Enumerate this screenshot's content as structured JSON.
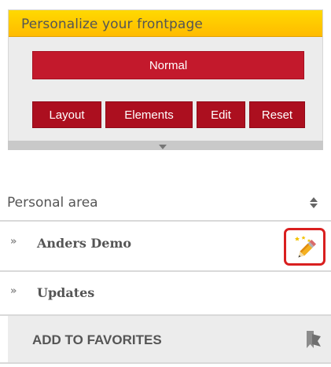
{
  "panel": {
    "title": "Personalize your frontpage",
    "mode_label": "Normal",
    "buttons": [
      {
        "label": "Layout"
      },
      {
        "label": "Elements"
      },
      {
        "label": "Edit"
      },
      {
        "label": "Reset"
      }
    ]
  },
  "personal_area": {
    "title": "Personal area",
    "items": [
      {
        "label": "Anders Demo",
        "bullet": "»"
      },
      {
        "label": "Updates",
        "bullet": "»"
      }
    ],
    "favorites_label": "ADD TO FAVORITES"
  },
  "colors": {
    "header_yellow": "#ffc800",
    "button_red": "#ac0f1f",
    "highlight_red": "#d91f1f"
  },
  "icons": [
    "collapse-arrow-icon",
    "sort-icon",
    "pencil-icon",
    "bookmark-icon"
  ]
}
